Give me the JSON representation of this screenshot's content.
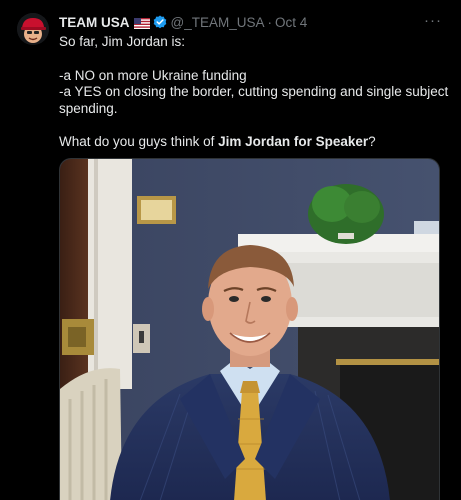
{
  "tweet": {
    "display_name": "TEAM USA",
    "handle": "@_TEAM_USA",
    "separator": "·",
    "date": "Oct 4",
    "more_label": "···",
    "lines": {
      "intro": "So far, Jim Jordan is:",
      "item1": "-a NO on more Ukraine funding",
      "item2": "-a YES on closing the border, cutting spending and single subject spending.",
      "question_prefix": "What do you guys think of ",
      "question_bold": "Jim Jordan for Speaker",
      "question_suffix": "?"
    }
  },
  "icons": {
    "avatar": "avatar-red-cap-icon",
    "flag": "us-flag-icon",
    "verified": "verified-badge-icon",
    "more": "more-options-icon"
  },
  "colors": {
    "background": "#000000",
    "text": "#e7e9ea",
    "muted": "#71767b",
    "verified": "#1d9bf0"
  }
}
